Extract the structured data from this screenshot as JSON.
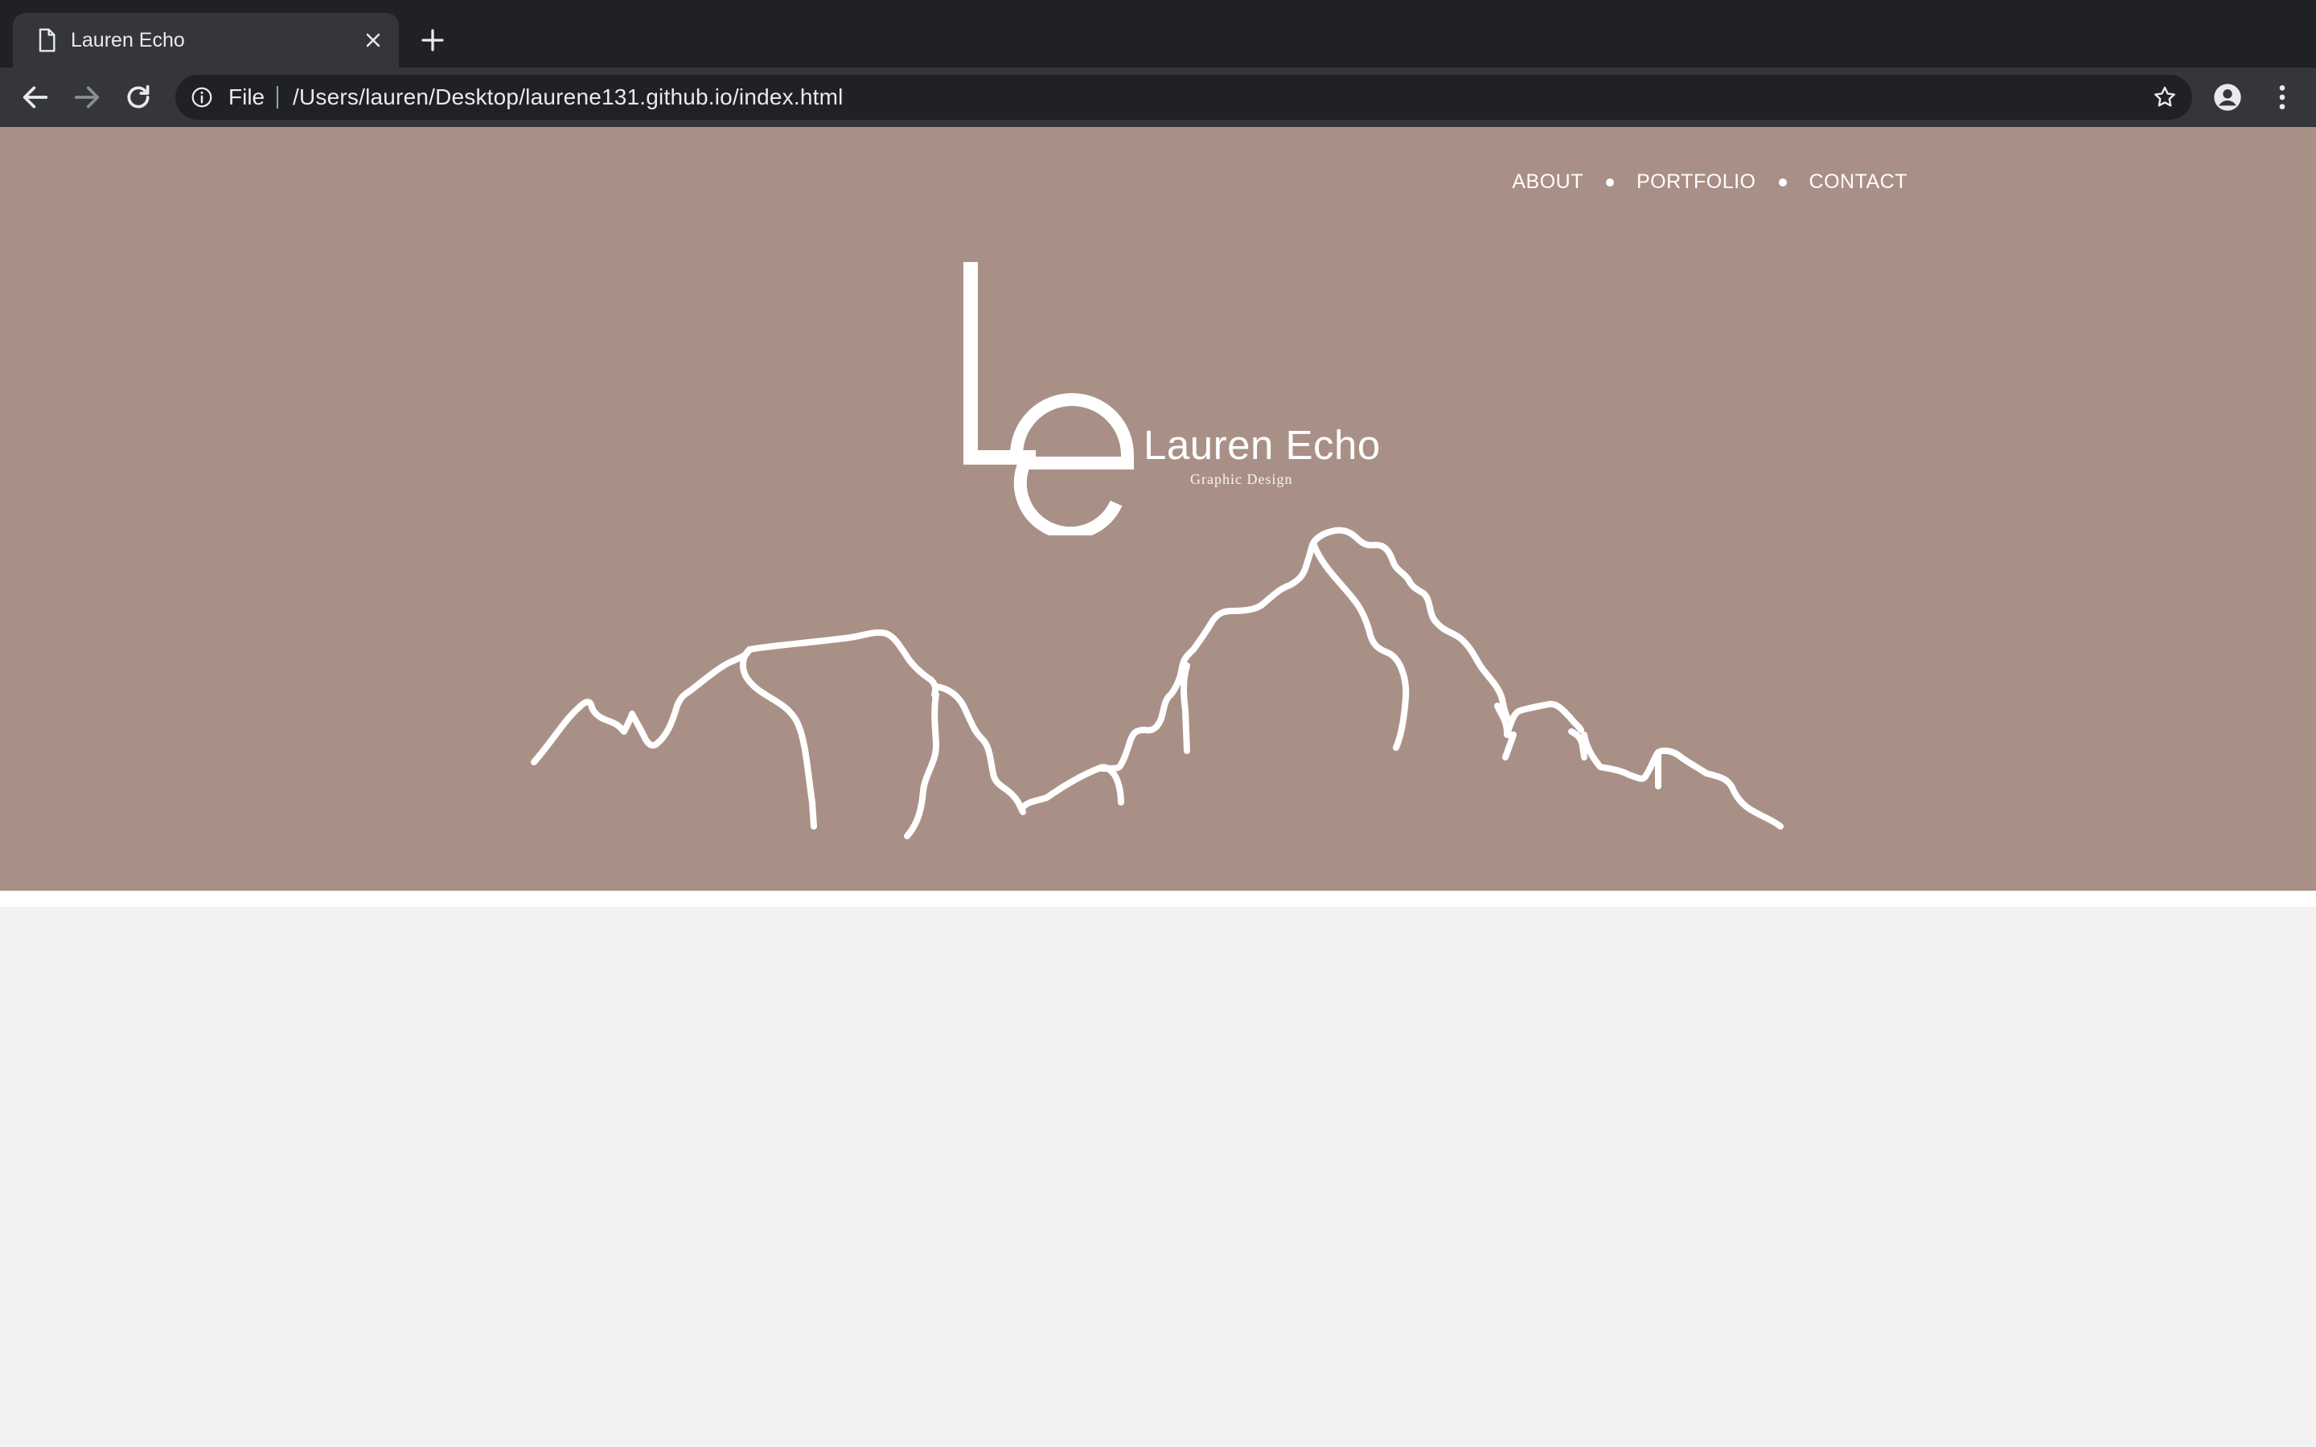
{
  "browser": {
    "tab": {
      "title": "Lauren Echo",
      "favicon": "document-icon"
    },
    "omnibox": {
      "scheme_label": "File",
      "url": "/Users/lauren/Desktop/laurene131.github.io/index.html"
    },
    "icons": [
      "back-icon",
      "forward-icon",
      "reload-icon",
      "info-icon",
      "star-icon",
      "profile-icon",
      "menu-icon",
      "close-icon",
      "plus-icon"
    ]
  },
  "site": {
    "nav": {
      "items": [
        {
          "label": "ABOUT"
        },
        {
          "label": "PORTFOLIO"
        },
        {
          "label": "CONTACT"
        }
      ]
    },
    "logo": {
      "monogram": "Le",
      "name": "Lauren Echo",
      "tagline": "Graphic Design"
    },
    "colors": {
      "hero_background": "#a99087",
      "page_background": "#f2f2f2",
      "foreground": "#ffffff"
    },
    "illustration": "mountain-line-art"
  }
}
